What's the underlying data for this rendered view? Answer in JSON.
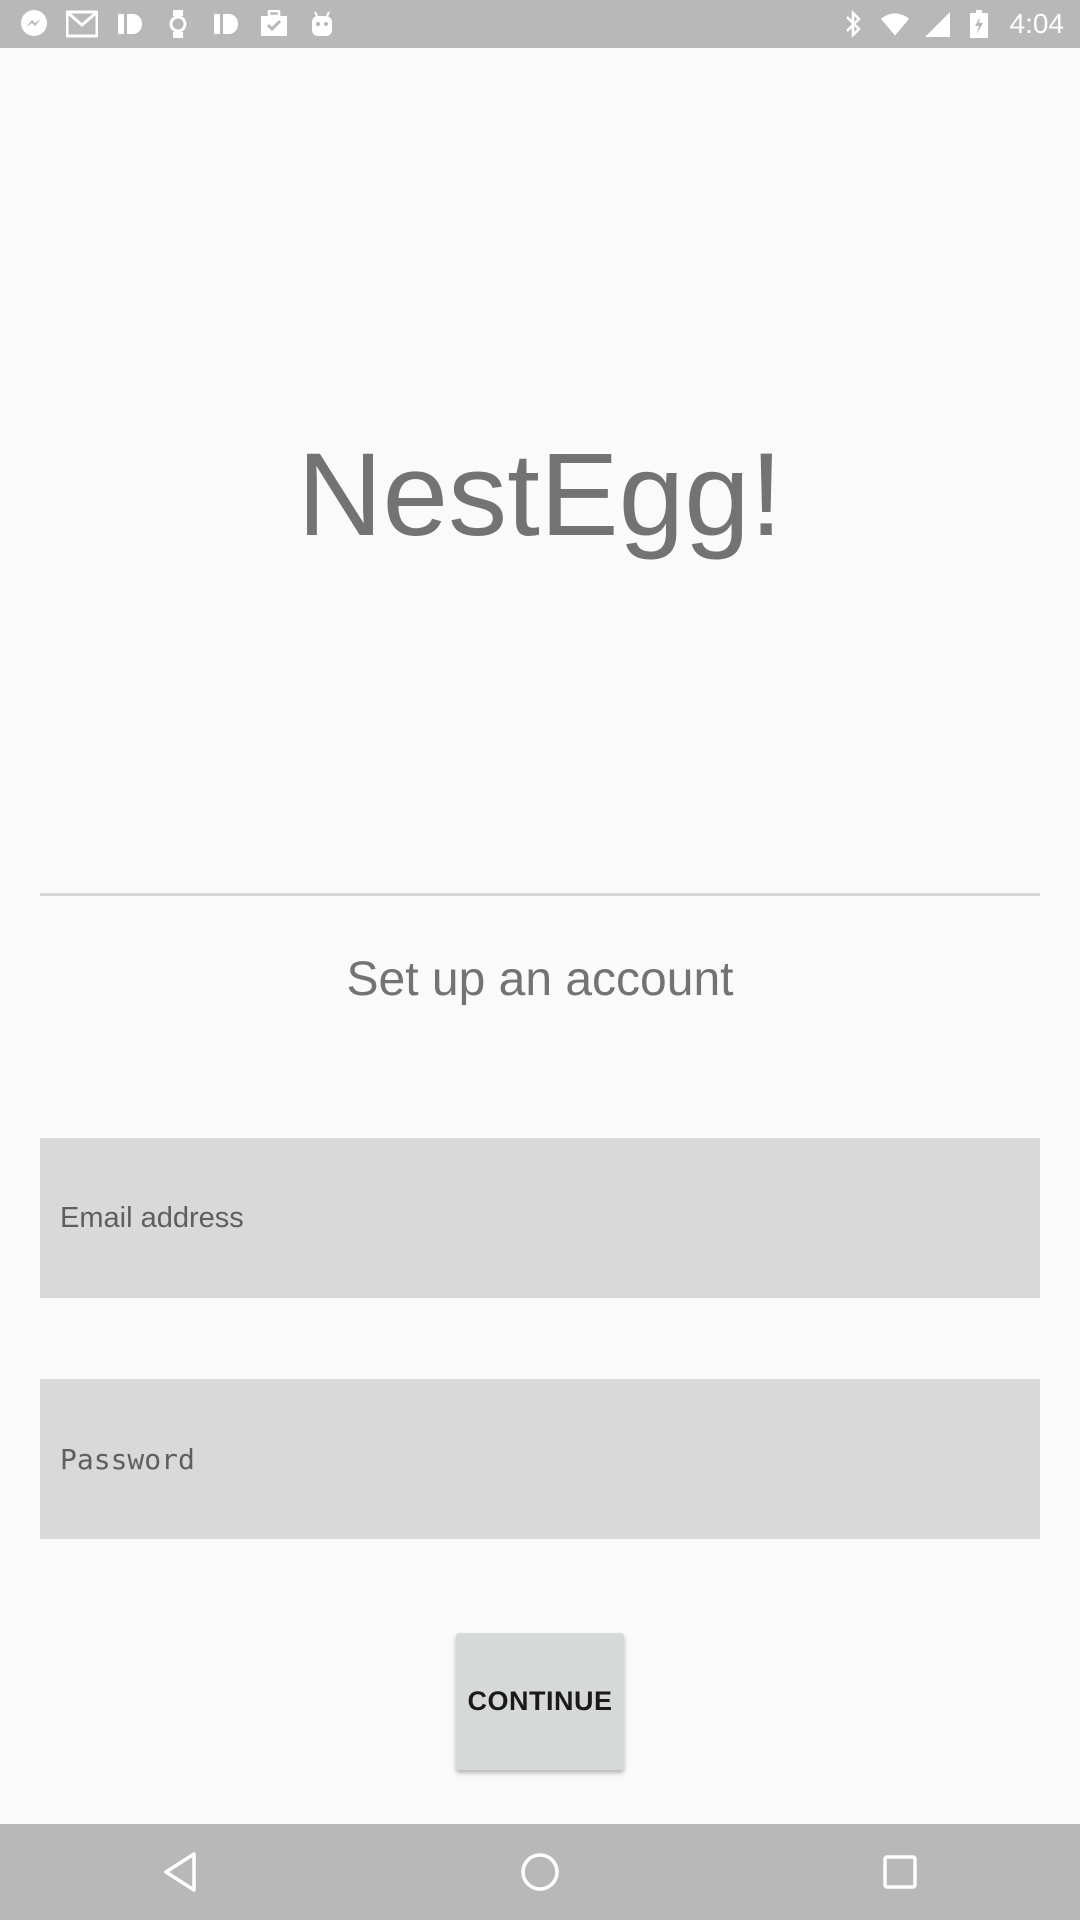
{
  "status_bar": {
    "time": "4:04",
    "left_icons": [
      "messenger-icon",
      "gmail-icon",
      "id-app-icon",
      "watch-icon",
      "id-app-icon",
      "briefcase-check-icon",
      "android-icon"
    ],
    "right_icons": [
      "bluetooth-icon",
      "wifi-icon",
      "cell-signal-icon",
      "battery-charging-icon"
    ]
  },
  "app": {
    "title": "NestEgg!"
  },
  "form": {
    "heading": "Set up an account",
    "email_placeholder": "Email address",
    "password_placeholder": "Password",
    "continue_label": "CONTINUE"
  },
  "nav_bar": {
    "icons": [
      "back-icon",
      "home-icon",
      "recents-icon"
    ]
  },
  "colors": {
    "status_bar_bg": "#b8b8b8",
    "background": "#fafafa",
    "field_bg": "#d9d9d9",
    "title_text": "#737373",
    "button_bg": "#d7d8d8"
  }
}
